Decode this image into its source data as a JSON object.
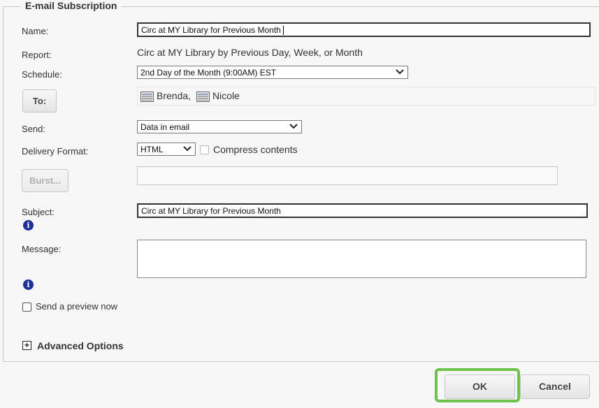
{
  "section_title": "E-mail Subscription",
  "name": {
    "label": "Name:",
    "value": "Circ at MY Library for Previous Month"
  },
  "report": {
    "label": "Report:",
    "value": "Circ at MY Library by Previous Day, Week, or Month"
  },
  "schedule": {
    "label": "Schedule:",
    "selected": "2nd Day of the Month (9:00AM) EST"
  },
  "to": {
    "button_label": "To:",
    "recipients": [
      "Brenda,",
      "Nicole"
    ]
  },
  "send": {
    "label": "Send:",
    "selected": "Data in email"
  },
  "delivery_format": {
    "label": "Delivery Format:",
    "selected": "HTML",
    "compress_label": "Compress contents"
  },
  "burst": {
    "button_label": "Burst...",
    "value": ""
  },
  "subject": {
    "label": "Subject:",
    "value": "Circ at MY Library for Previous Month"
  },
  "message": {
    "label": "Message:",
    "value": ""
  },
  "preview": {
    "label": "Send a preview now"
  },
  "advanced": {
    "label": "Advanced Options"
  },
  "footer": {
    "ok_label": "OK",
    "cancel_label": "Cancel"
  },
  "colors": {
    "highlight": "#6cc24a",
    "info_icon": "#1d2f9a"
  },
  "icons": [
    "recipient-icon",
    "info-icon",
    "chevron-down-icon",
    "expand-plus-icon"
  ]
}
